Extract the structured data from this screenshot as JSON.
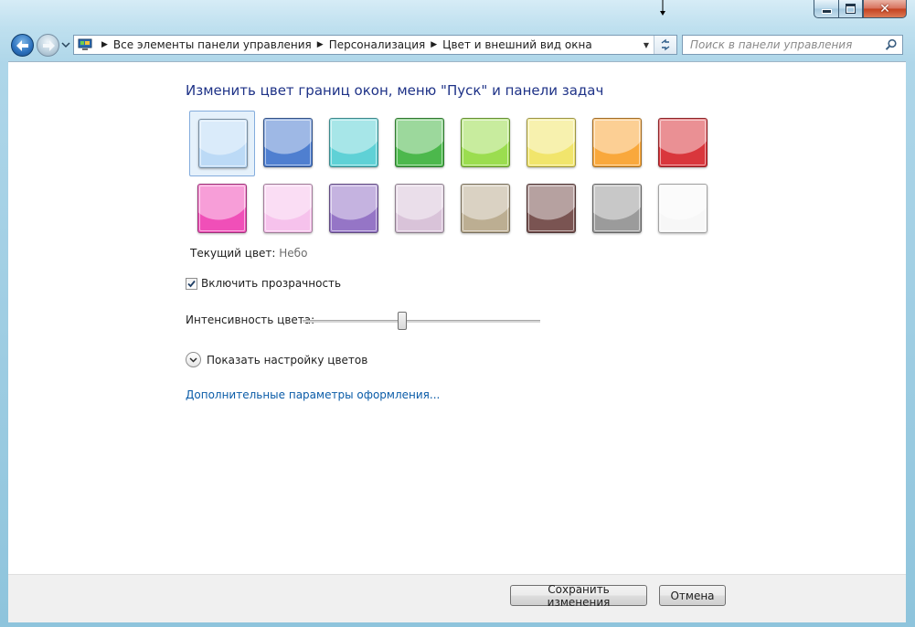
{
  "breadcrumbs": [
    "Все элементы панели управления",
    "Персонализация",
    "Цвет и внешний вид окна"
  ],
  "search": {
    "placeholder": "Поиск в панели управления"
  },
  "main": {
    "title": "Изменить цвет границ окон, меню \"Пуск\" и панели задач",
    "swatches": [
      {
        "color": "#bcdaf6"
      },
      {
        "color": "#4f7fd0"
      },
      {
        "color": "#5fd1d6"
      },
      {
        "color": "#4cb84c"
      },
      {
        "color": "#9bdd4f"
      },
      {
        "color": "#f1e56c"
      },
      {
        "color": "#f9a83c"
      },
      {
        "color": "#d9363c"
      },
      {
        "color": "#f04fb8"
      },
      {
        "color": "#f6c2ec"
      },
      {
        "color": "#9575c6"
      },
      {
        "color": "#d9c3d9"
      },
      {
        "color": "#bcae92"
      },
      {
        "color": "#7a5452"
      },
      {
        "color": "#9b9b9b"
      },
      {
        "color": "#f7f7f7"
      }
    ],
    "current_color_label": "Текущий цвет:",
    "current_color_value": "Небо",
    "transparency_label": "Включить прозрачность",
    "transparency_checked": true,
    "intensity_label": "Интенсивность цвета:",
    "intensity_level": 0.42,
    "show_mixer_label": "Показать настройку цветов",
    "advanced_link": "Дополнительные параметры оформления..."
  },
  "footer": {
    "save_label": "Сохранить изменения",
    "cancel_label": "Отмена"
  }
}
